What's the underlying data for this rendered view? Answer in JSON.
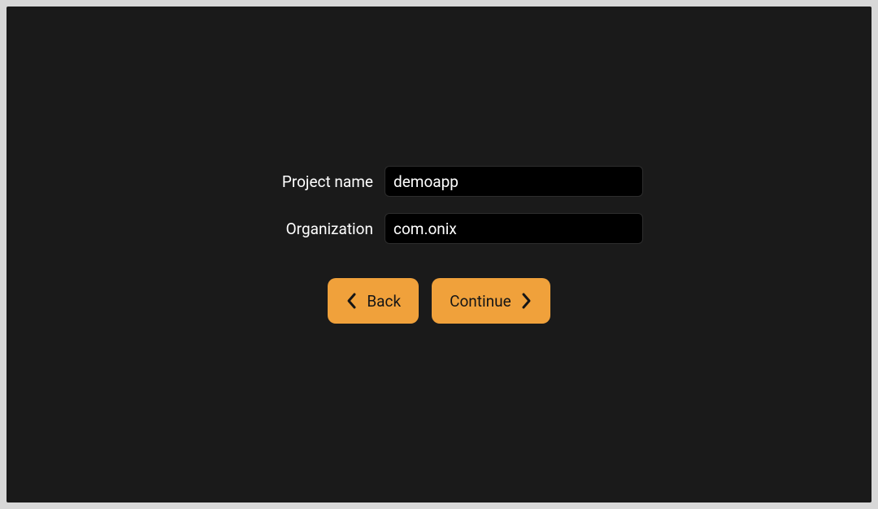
{
  "form": {
    "project_name": {
      "label": "Project name",
      "value": "demoapp"
    },
    "organization": {
      "label": "Organization",
      "value": "com.onix"
    }
  },
  "buttons": {
    "back": "Back",
    "continue": "Continue"
  },
  "colors": {
    "background": "#1a1a1a",
    "input_bg": "#000000",
    "button_bg": "#f0a13b",
    "text": "#ffffff",
    "button_text": "#161616"
  }
}
